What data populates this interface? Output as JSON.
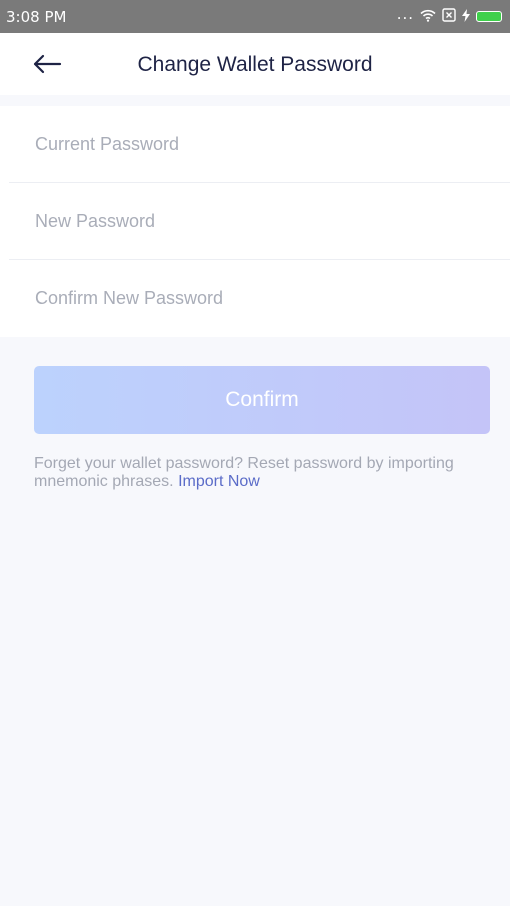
{
  "status_bar": {
    "time": "3:08 PM",
    "dots": "...",
    "wifi_icon": "wifi-icon",
    "sim_icon": "sim-x-icon",
    "charging_icon": "bolt-icon",
    "battery_icon": "battery-icon",
    "battery_color": "#3fd04b"
  },
  "header": {
    "back_icon": "arrow-left-icon",
    "title": "Change Wallet Password"
  },
  "form": {
    "current_password_placeholder": "Current Password",
    "new_password_placeholder": "New Password",
    "confirm_password_placeholder": "Confirm New Password"
  },
  "confirm_button": {
    "label": "Confirm",
    "gradient_start": "#bcd2fd",
    "gradient_end": "#c4c4f8"
  },
  "hint": {
    "text": "Forget your wallet password? Reset password by importing mnemonic phrases. ",
    "link_label": "Import Now",
    "link_color": "#5b6cc8"
  }
}
